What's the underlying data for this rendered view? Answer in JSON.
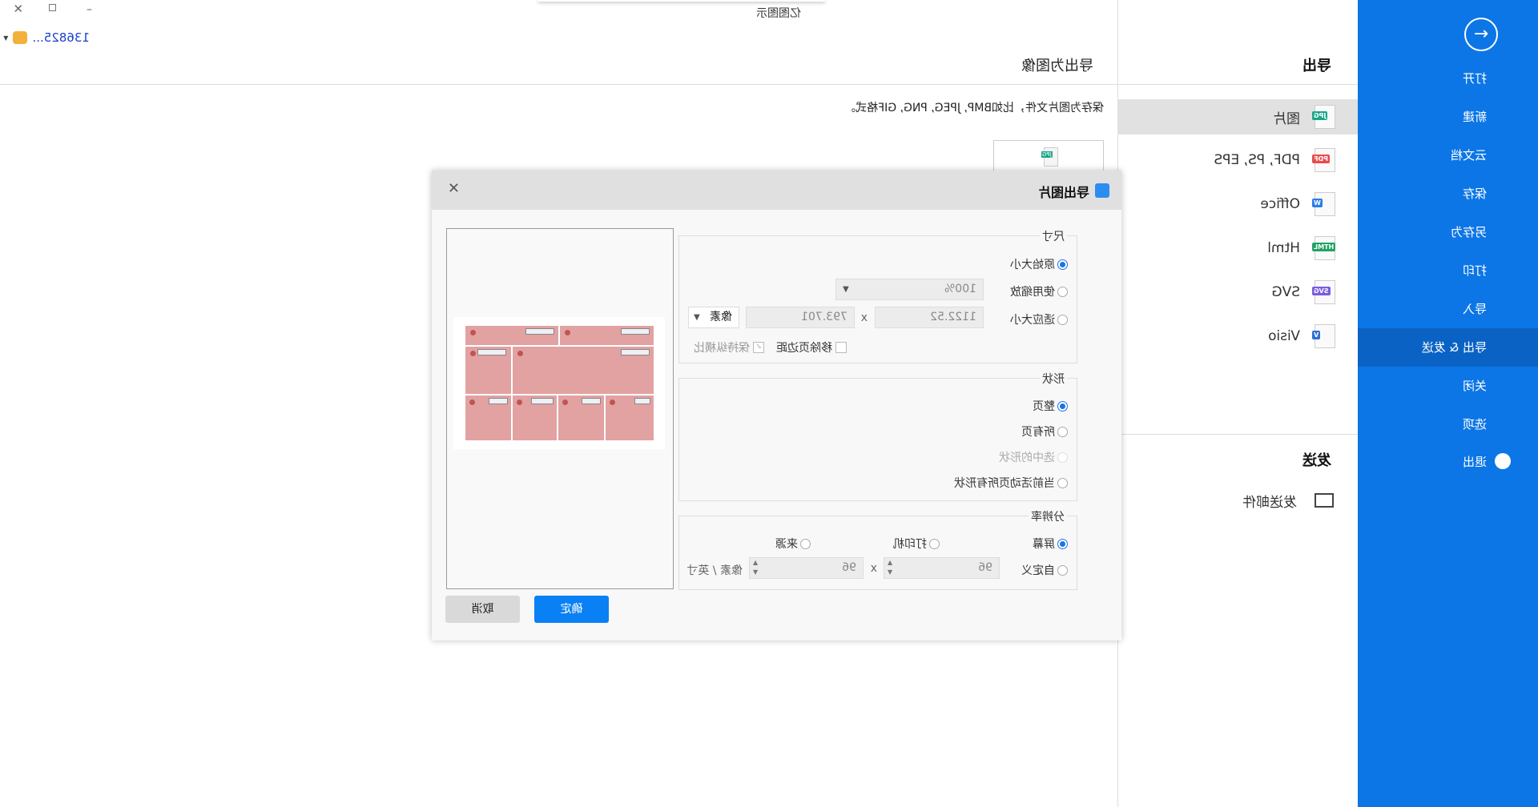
{
  "titlebar": {
    "app_title": "亿图图示",
    "user": "136825...",
    "icons": [
      "close-icon",
      "restore-icon",
      "minimize-icon",
      "vip-diamond-icon",
      "dropdown-arrow-icon"
    ]
  },
  "sidebar": {
    "items": [
      {
        "label": "打开"
      },
      {
        "label": "新建"
      },
      {
        "label": "云文档"
      },
      {
        "label": "保存"
      },
      {
        "label": "另存为"
      },
      {
        "label": "打印"
      },
      {
        "label": "导入"
      },
      {
        "label": "导出 & 发送",
        "active": true
      },
      {
        "label": "关闭"
      },
      {
        "label": "选项"
      },
      {
        "label": "退出"
      }
    ],
    "accent": "#0c76e6"
  },
  "export_panel": {
    "heading": "导出",
    "formats": [
      {
        "label": "图片",
        "tag": "JPG",
        "color": "#1aa58a",
        "active": true
      },
      {
        "label": "PDF, PS, EPS",
        "tag": "PDF",
        "color": "#e94b4b"
      },
      {
        "label": "Office",
        "tag": "W",
        "color": "#2b7de9"
      },
      {
        "label": "Html",
        "tag": "HTML",
        "color": "#21a366"
      },
      {
        "label": "SVG",
        "tag": "SVG",
        "color": "#7b5ce0"
      },
      {
        "label": "Visio",
        "tag": "V",
        "color": "#2f6fd6"
      }
    ],
    "send_heading": "发送",
    "send_email": "发送邮件"
  },
  "content": {
    "title": "导出为图像",
    "description": "保存为图片文件，比如BMP, JPEG, PNG, GIF格式。",
    "thumb_tag": "JPG"
  },
  "dialog": {
    "title": "导出图片",
    "size": {
      "legend": "尺寸",
      "original": "原始大小",
      "use_zoom": "使用缩放",
      "zoom_value": "100%",
      "fit": "适应大小",
      "width": "1122.52",
      "x": "x",
      "height": "793.701",
      "unit": "像素",
      "remove_margin": "移除页边距",
      "keep_ratio": "保持纵横比",
      "selected": "原始大小"
    },
    "shape": {
      "legend": "形状",
      "options": [
        "整页",
        "所有页",
        "选中的形状",
        "当前活动页所有形状"
      ],
      "selected": "整页"
    },
    "resolution": {
      "legend": "分辨率",
      "screen": "屏幕",
      "printer": "打印机",
      "source": "来源",
      "custom": "自定义",
      "dpi_x": "96",
      "x": "x",
      "dpi_y": "96",
      "unit": "像素 / 英寸",
      "selected": "屏幕"
    },
    "ok": "确定",
    "cancel": "取消"
  }
}
